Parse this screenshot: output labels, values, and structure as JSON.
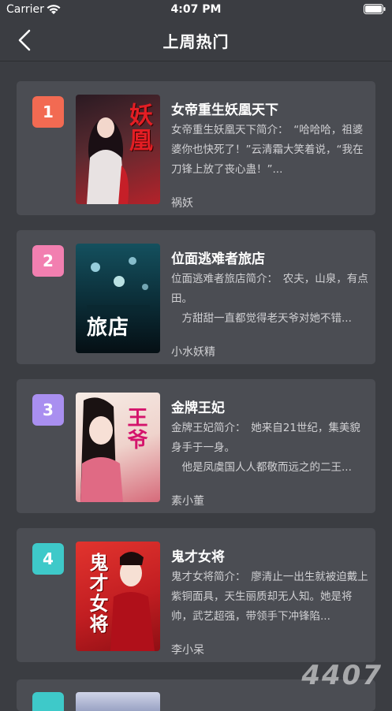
{
  "status_bar": {
    "carrier": "Carrier",
    "time": "4:07 PM"
  },
  "nav": {
    "title": "上周热门"
  },
  "books": [
    {
      "rank": "1",
      "rank_color": "#f26a52",
      "title": "女帝重生妖凰天下",
      "desc": "女帝重生妖凰天下简介：　“哈哈哈，祖婆婆你也快死了！”云清霜大笑着说，“我在刀锋上放了丧心蛊！”...",
      "author": "祸妖",
      "cover_text": "妖凰",
      "cover_colors": [
        "#2a1a22",
        "#b4222a"
      ]
    },
    {
      "rank": "2",
      "rank_color": "#f27fb0",
      "title": "位面逃难者旅店",
      "desc": "位面逃难者旅店简介：　农夫，山泉，有点田。\n　方甜甜一直都觉得老天爷对她不错...",
      "author": "小水妖精",
      "cover_text": "旅店",
      "cover_colors": [
        "#0f3d4a",
        "#061a22"
      ]
    },
    {
      "rank": "3",
      "rank_color": "#a98ff0",
      "title": "金牌王妃",
      "desc": "金牌王妃简介：　她来自21世纪，集美貌身手于一身。\n　他是凤虞国人人都敬而远之的二王...",
      "author": "素小董",
      "cover_text": "王爷",
      "cover_colors": [
        "#f3e4dc",
        "#d66a7a"
      ]
    },
    {
      "rank": "4",
      "rank_color": "#3ec9c9",
      "title": "鬼才女将",
      "desc": "鬼才女将简介：　廖清止一出生就被迫戴上紫铜面具，天生丽质却无人知。她是将帅，武艺超强，带领手下冲锋陷...",
      "author": "李小呆",
      "cover_text": "鬼才女将",
      "cover_colors": [
        "#d8282a",
        "#8f0f14"
      ]
    }
  ],
  "watermark": "4407"
}
